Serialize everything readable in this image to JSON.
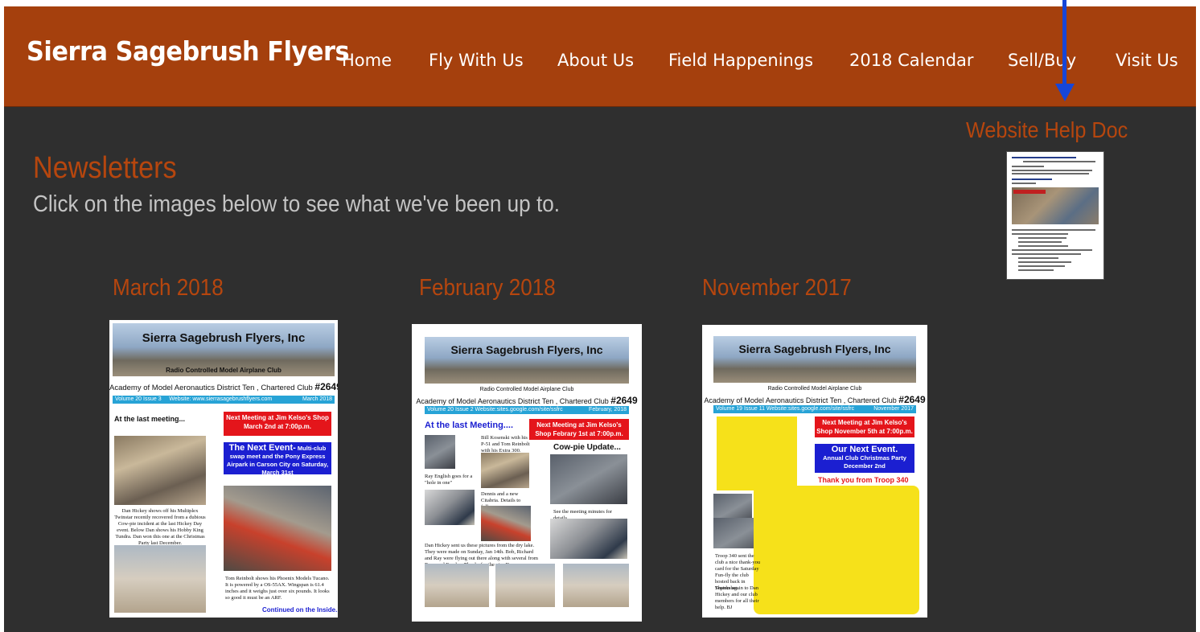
{
  "site": {
    "title": "Sierra Sagebrush Flyers",
    "nav": [
      "Home",
      "Fly With Us",
      "About Us",
      "Field Happenings",
      "2018 Calendar",
      "Sell/Buy",
      "Visit Us"
    ]
  },
  "help": {
    "title": "Website Help Doc",
    "arrow_color": "#1646d8"
  },
  "main": {
    "heading": "Newsletters",
    "subtitle": "Click on the images below to see what we've been up to."
  },
  "colors": {
    "header_bg": "#a5400d",
    "page_bg": "#2f2f2f",
    "accent": "#b6460e",
    "subtitle_text": "#c4c4c4"
  },
  "newsletters": [
    {
      "label": "March 2018",
      "masthead": "Sierra Sagebrush Flyers, Inc",
      "masthead_sub": "Radio Controlled Model Airplane Club",
      "academy_text": "Academy of Model Aeronautics District Ten , Chartered Club ",
      "club_no": "#2649",
      "issue": "Volume 20 Issue 3",
      "website": "Website: www.sierrasagebrushflyers.com",
      "date": "March 2018",
      "headline": "At the last meeting...",
      "red_box": "Next Meeting at Jim Kelso's Shop March 2nd at 7:00p.m.",
      "blue_title": "The Next Event-",
      "blue_text": "Multi-club swap meet and the Pony Express Airpark in Carson City on Saturday, March 31st",
      "caption_left": "Dan Hickey shows off his Multiplex Twinstar recently recovered from a dubious Cow-pie incident at the last Hickey Day event. Below Dan shows his Hobby King Tundra. Dan won this one at the Christmas Party last December.",
      "caption_right": "Tom Reinbolt shows his Phoenix Models Tucano. It is powered by a OS-55AX. Wingspan is 61.4 inches and it weighs just over six pounds. It looks so good it must be an ARF.",
      "continued": "Continued on the Inside..."
    },
    {
      "label": "February 2018",
      "masthead": "Sierra Sagebrush Flyers, Inc",
      "masthead_sub": "Radio Controlled Model Airplane Club",
      "academy_text": "Academy of Model Aeronautics District Ten , Chartered Club ",
      "club_no": "#2649",
      "issue": "Volume 20 Issue 2 Website:sites.google.com/site/ssfrc",
      "date": "February, 2018",
      "headline": "At the last Meeting....",
      "red_box": "Next Meeting at Jim Kelso's Shop Febrary 1st at 7:00p.m.",
      "side_headline": "Cow-pie Update...",
      "caption_1": "Bill Kosenski with his P-51 and Tom Reinbolt with his Extra 300.",
      "caption_2": "Ray English goes for a \"hole in one\"",
      "caption_3": "Dennis and a new Citabria. Details to follow.",
      "caption_4": "See the meeting minutes for details.....",
      "caption_5": "Dan Hickey sent us these pictures from the dry lake. They were made on Sunday, Jan 14th. Bob, Richard and Ray were flying out there along with several from Reno and Fernley. Thanks for the pics Dan."
    },
    {
      "label": "November 2017",
      "masthead": "Sierra Sagebrush Flyers, Inc",
      "masthead_sub": "Radio Controlled Model Airplane Club",
      "academy_text": "Academy of Model Aeronautics District Ten , Chartered Club ",
      "club_no": "#2649",
      "issue": "Volume 19 Issue 11 Website:sites.google.com/site/ssfrc",
      "date": "November 2017",
      "red_box": "Next Meeting at Jim Kelso's Shop November 5th at 7:00p.m.",
      "blue_title": "Our Next Event.",
      "blue_text": "Annual Club Christmas Party December 2nd",
      "thanks": "Thank you from Troop 340",
      "caption_1": "Troop 340 sent the club a nice thank-you card for the Saturday Fun-fly the club hosted back in September.",
      "caption_2": "Thanks again to Dan Hickey and our club members for all their help. BJ"
    }
  ]
}
